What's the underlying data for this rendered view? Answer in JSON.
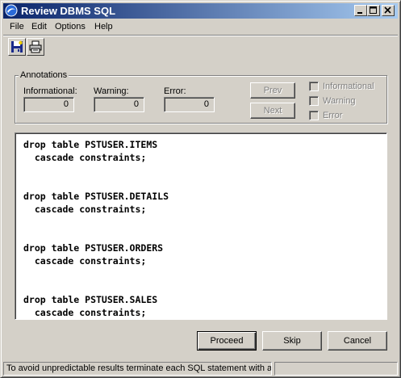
{
  "window": {
    "title": "Review DBMS SQL",
    "icon": "app-icon",
    "controls": [
      "minimize-icon",
      "maximize-icon",
      "close-icon"
    ]
  },
  "menu": {
    "items": [
      "File",
      "Edit",
      "Options",
      "Help"
    ]
  },
  "toolbar": {
    "buttons": [
      "save-icon",
      "print-icon"
    ]
  },
  "annotations": {
    "title": "Annotations",
    "informational_label": "Informational:",
    "warning_label": "Warning:",
    "error_label": "Error:",
    "informational_count": "0",
    "warning_count": "0",
    "error_count": "0",
    "prev_label": "Prev",
    "next_label": "Next",
    "filters": [
      {
        "label": "Informational",
        "checked": false
      },
      {
        "label": "Warning",
        "checked": false
      },
      {
        "label": "Error",
        "checked": false
      }
    ]
  },
  "sql": {
    "lines": [
      "drop table PSTUSER.ITEMS",
      "  cascade constraints;",
      "drop table PSTUSER.DETAILS",
      "  cascade constraints;",
      "drop table PSTUSER.ORDERS",
      "  cascade constraints;",
      "drop table PSTUSER.SALES",
      "  cascade constraints;"
    ]
  },
  "actions": {
    "proceed_label": "Proceed",
    "skip_label": "Skip",
    "cancel_label": "Cancel"
  },
  "status": {
    "text": "To avoid unpredictable results terminate each SQL statement with a semicolon"
  },
  "colors": {
    "title_start": "#0a246a",
    "title_end": "#a6caf0",
    "face": "#d4d0c8"
  }
}
